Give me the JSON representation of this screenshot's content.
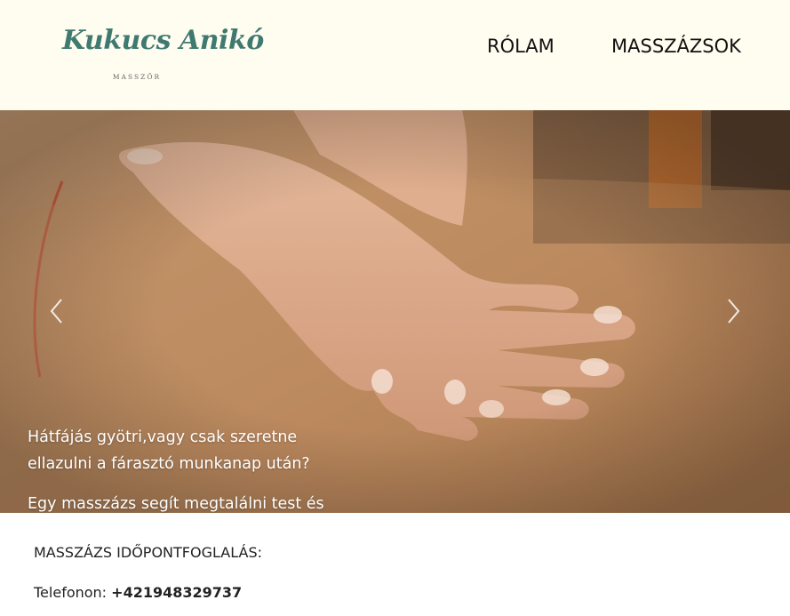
{
  "header": {
    "logo_script": "Kukucs Anikó",
    "logo_subtitle": "MASSZŐR",
    "nav": [
      {
        "label": "RÓLAM"
      },
      {
        "label": "MASSZÁZSOK"
      }
    ]
  },
  "hero": {
    "caption_line_1": "Hátfájás gyötri,vagy csak szeretne ellazulni a fárasztó munkanap után?",
    "caption_line_2": "Egy masszázs segít megtalálni test és lélek harmóniáját.",
    "prev_icon": "chevron-left-icon",
    "next_icon": "chevron-right-icon"
  },
  "contact": {
    "booking_title": "MASSZÁZS IDŐPONTFOGLALÁS:",
    "phone_label": "Telefonon:",
    "phone_number": "+421948329737"
  },
  "colors": {
    "header_bg": "#fffdf0",
    "logo_green": "#3f7a70",
    "caption_text": "#ffffff"
  }
}
